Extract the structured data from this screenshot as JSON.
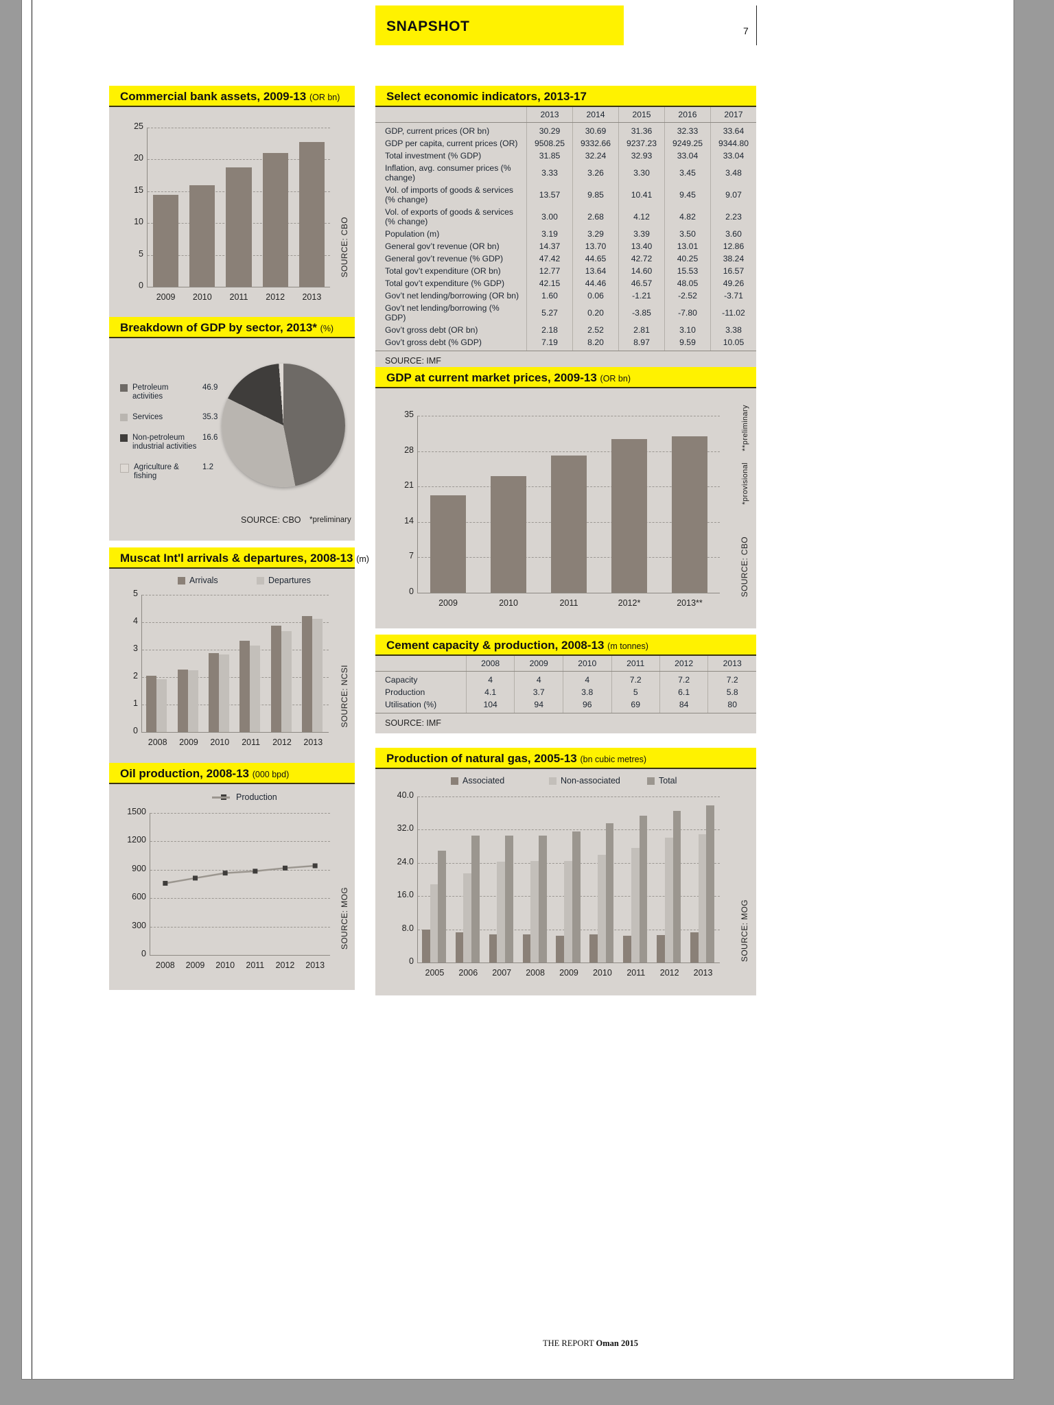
{
  "header": {
    "title": "SNAPSHOT",
    "page_number": "7"
  },
  "footer": {
    "prefix": "THE REPORT",
    "bold": "Oman 2015"
  },
  "bank_assets": {
    "title": "Commercial bank assets, 2009-13",
    "unit": "(OR bn)",
    "source": "SOURCE: CBO",
    "chart_data": {
      "type": "bar",
      "title": "Commercial bank assets, 2009-13 (OR bn)",
      "categories": [
        "2009",
        "2010",
        "2011",
        "2012",
        "2013"
      ],
      "values": [
        14.4,
        16.0,
        18.8,
        21.0,
        22.7
      ],
      "ylabel": "",
      "xlabel": "",
      "yticks": [
        "0",
        "5",
        "10",
        "15",
        "20",
        "25"
      ],
      "ylim": [
        0,
        25
      ],
      "grid": true
    }
  },
  "gdp_sector": {
    "title": "Breakdown of GDP by sector, 2013*",
    "unit": "(%)",
    "source": "SOURCE: CBO",
    "note": "*preliminary",
    "chart_data": {
      "type": "pie",
      "title": "Breakdown of GDP by sector, 2013* (%)",
      "categories": [
        "Petroleum activities",
        "Services",
        "Non-petroleum industrial activities",
        "Agriculture & fishing"
      ],
      "values": [
        46.9,
        35.3,
        16.6,
        1.2
      ],
      "colors": [
        "#6e6a66",
        "#b9b5b0",
        "#3f3d3b",
        "#ded9d4"
      ],
      "legend": "left"
    }
  },
  "muscat": {
    "title": "Muscat Int'l arrivals & departures, 2008-13",
    "unit": "(m)",
    "source": "SOURCE: NCSI",
    "chart_data": {
      "type": "bar",
      "title": "Muscat Int'l arrivals & departures, 2008-13 (m)",
      "categories": [
        "2008",
        "2009",
        "2010",
        "2011",
        "2012",
        "2013"
      ],
      "series": [
        {
          "name": "Arrivals",
          "values": [
            2.05,
            2.27,
            2.87,
            3.33,
            3.87,
            4.22
          ]
        },
        {
          "name": "Departures",
          "values": [
            1.93,
            2.24,
            2.82,
            3.15,
            3.68,
            4.12
          ]
        }
      ],
      "yticks": [
        "0",
        "1",
        "2",
        "3",
        "4",
        "5"
      ],
      "ylim": [
        0,
        5
      ],
      "grid": true
    }
  },
  "oil": {
    "title": "Oil production, 2008-13",
    "unit": "(000 bpd)",
    "source": "SOURCE: MOG",
    "chart_data": {
      "type": "line",
      "title": "Oil production, 2008-13 (000 bpd)",
      "categories": [
        "2008",
        "2009",
        "2010",
        "2011",
        "2012",
        "2013"
      ],
      "series": [
        {
          "name": "Production",
          "values": [
            757,
            812,
            865,
            885,
            918,
            942
          ]
        }
      ],
      "yticks": [
        "0",
        "300",
        "600",
        "900",
        "1200",
        "1500"
      ],
      "ylim": [
        0,
        1500
      ],
      "grid": true
    }
  },
  "indicators": {
    "title": "Select economic indicators, 2013-17",
    "source": "SOURCE: IMF",
    "columns": [
      "",
      "2013",
      "2014",
      "2015",
      "2016",
      "2017"
    ],
    "rows": [
      {
        "label": "GDP, current prices (OR bn)",
        "values": [
          "30.29",
          "30.69",
          "31.36",
          "32.33",
          "33.64"
        ]
      },
      {
        "label": "GDP per capita, current prices (OR)",
        "values": [
          "9508.25",
          "9332.66",
          "9237.23",
          "9249.25",
          "9344.80"
        ]
      },
      {
        "label": "Total investment (% GDP)",
        "values": [
          "31.85",
          "32.24",
          "32.93",
          "33.04",
          "33.04"
        ]
      },
      {
        "label": "Inflation, avg. consumer prices (% change)",
        "values": [
          "3.33",
          "3.26",
          "3.30",
          "3.45",
          "3.48"
        ]
      },
      {
        "label": "Vol. of imports of goods & services (% change)",
        "values": [
          "13.57",
          "9.85",
          "10.41",
          "9.45",
          "9.07"
        ]
      },
      {
        "label": "Vol. of exports of goods & services (% change)",
        "values": [
          "3.00",
          "2.68",
          "4.12",
          "4.82",
          "2.23"
        ]
      },
      {
        "label": "Population (m)",
        "values": [
          "3.19",
          "3.29",
          "3.39",
          "3.50",
          "3.60"
        ]
      },
      {
        "label": "General gov’t revenue (OR bn)",
        "values": [
          "14.37",
          "13.70",
          "13.40",
          "13.01",
          "12.86"
        ]
      },
      {
        "label": "General gov’t revenue (% GDP)",
        "values": [
          "47.42",
          "44.65",
          "42.72",
          "40.25",
          "38.24"
        ]
      },
      {
        "label": "Total gov’t expenditure (OR bn)",
        "values": [
          "12.77",
          "13.64",
          "14.60",
          "15.53",
          "16.57"
        ]
      },
      {
        "label": "Total gov’t expenditure (% GDP)",
        "values": [
          "42.15",
          "44.46",
          "46.57",
          "48.05",
          "49.26"
        ]
      },
      {
        "label": "Gov’t net lending/borrowing (OR bn)",
        "values": [
          "1.60",
          "0.06",
          "-1.21",
          "-2.52",
          "-3.71"
        ]
      },
      {
        "label": "Gov’t net lending/borrowing (% GDP)",
        "values": [
          "5.27",
          "0.20",
          "-3.85",
          "-7.80",
          "-11.02"
        ]
      },
      {
        "label": "Gov’t gross debt (OR bn)",
        "values": [
          "2.18",
          "2.52",
          "2.81",
          "3.10",
          "3.38"
        ]
      },
      {
        "label": "Gov’t gross debt (% GDP)",
        "values": [
          "7.19",
          "8.20",
          "8.97",
          "9.59",
          "10.05"
        ]
      }
    ]
  },
  "gdp_market": {
    "title": "GDP at current market prices, 2009-13",
    "unit": "(OR bn)",
    "source": "SOURCE: CBO",
    "note1": "*provisional",
    "note2": "**preliminary",
    "chart_data": {
      "type": "bar",
      "title": "GDP at current market prices, 2009-13 (OR bn)",
      "categories": [
        "2009",
        "2010",
        "2011",
        "2012*",
        "2013**"
      ],
      "values": [
        19.2,
        23.1,
        27.1,
        30.4,
        31.0
      ],
      "yticks": [
        "0",
        "7",
        "14",
        "21",
        "28",
        "35"
      ],
      "ylim": [
        0,
        35
      ],
      "grid": true
    }
  },
  "cement": {
    "title": "Cement capacity & production, 2008-13",
    "unit": "(m tonnes)",
    "source": "SOURCE: IMF",
    "columns": [
      "",
      "2008",
      "2009",
      "2010",
      "2011",
      "2012",
      "2013"
    ],
    "rows": [
      {
        "label": "Capacity",
        "values": [
          "4",
          "4",
          "4",
          "7.2",
          "7.2",
          "7.2"
        ]
      },
      {
        "label": "Production",
        "values": [
          "4.1",
          "3.7",
          "3.8",
          "5",
          "6.1",
          "5.8"
        ]
      },
      {
        "label": "Utilisation (%)",
        "values": [
          "104",
          "94",
          "96",
          "69",
          "84",
          "80"
        ]
      }
    ]
  },
  "gas": {
    "title": "Production of natural gas, 2005-13",
    "unit": "(bn cubic metres)",
    "source": "SOURCE: MOG",
    "chart_data": {
      "type": "bar",
      "title": "Production of natural gas, 2005-13 (bn cubic metres)",
      "categories": [
        "2005",
        "2006",
        "2007",
        "2008",
        "2009",
        "2010",
        "2011",
        "2012",
        "2013"
      ],
      "series": [
        {
          "name": "Associated",
          "values": [
            8.0,
            7.3,
            6.7,
            6.7,
            6.4,
            6.8,
            6.4,
            6.6,
            7.2
          ]
        },
        {
          "name": "Non-associated",
          "values": [
            18.9,
            21.5,
            24.3,
            24.5,
            24.4,
            25.9,
            27.6,
            30.1,
            30.9
          ]
        },
        {
          "name": "Total",
          "values": [
            26.9,
            30.5,
            30.6,
            30.5,
            31.6,
            33.6,
            35.3,
            36.5,
            37.8
          ]
        }
      ],
      "yticks": [
        "0",
        "8.0",
        "16.0",
        "24.0",
        "32.0",
        "40.0"
      ],
      "ylim": [
        0,
        40
      ],
      "grid": true
    }
  }
}
